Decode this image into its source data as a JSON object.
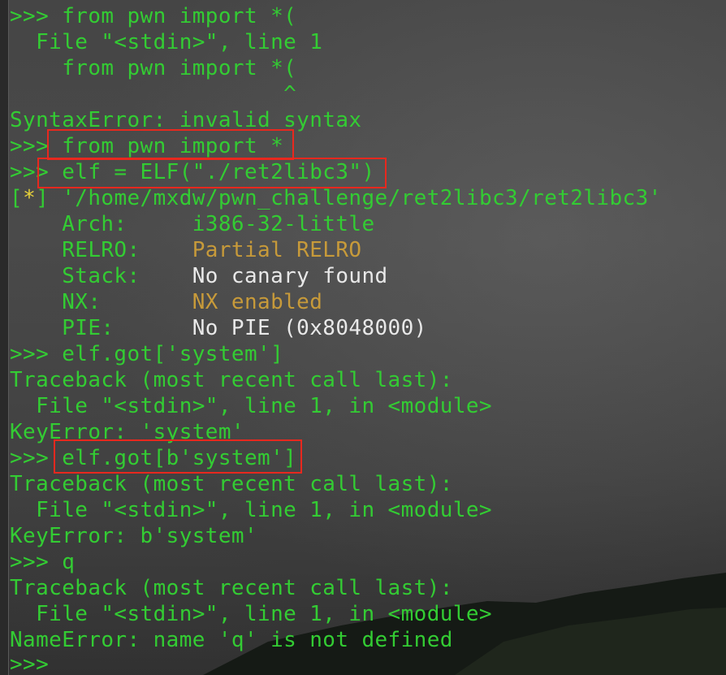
{
  "terminal": {
    "lines": [
      ">>> from pwn import *(",
      "  File \"<stdin>\", line 1",
      "    from pwn import *(",
      "                     ^",
      "SyntaxError: invalid syntax",
      ">>> from pwn import *",
      ">>> elf = ELF(\"./ret2libc3\")",
      "] '/home/mxdw/pwn_challenge/ret2libc3/ret2libc3'",
      "    Arch:     i386-32-little",
      "    RELRO:    Partial RELRO",
      "    Stack:    No canary found",
      "    NX:       NX enabled",
      "    PIE:      No PIE (0x8048000)",
      ">>> elf.got['system']",
      "Traceback (most recent call last):",
      "  File \"<stdin>\", line 1, in <module>",
      "KeyError: 'system'",
      ">>> elf.got[b'system']",
      "Traceback (most recent call last):",
      "  File \"<stdin>\", line 1, in <module>",
      "KeyError: b'system'",
      ">>> q",
      "Traceback (most recent call last):",
      "  File \"<stdin>\", line 1, in <module>",
      "NameError: name 'q' is not defined",
      ">>>"
    ],
    "info_prefix": "[",
    "info_star": "*",
    "checksec": {
      "arch_label": "    Arch:     ",
      "arch_value": "i386-32-little",
      "relro_label": "    RELRO:    ",
      "relro_value": "Partial RELRO",
      "stack_label": "    Stack:    ",
      "stack_value": "No canary found",
      "nx_label": "    NX:       ",
      "nx_value": "NX enabled",
      "pie_label": "    PIE:      ",
      "pie_value": "No PIE (0x8048000)"
    },
    "colors": {
      "text": "#33cc33",
      "white": "#e8e8e8",
      "amber": "#c79a3a",
      "highlight": "#e8281e"
    }
  }
}
